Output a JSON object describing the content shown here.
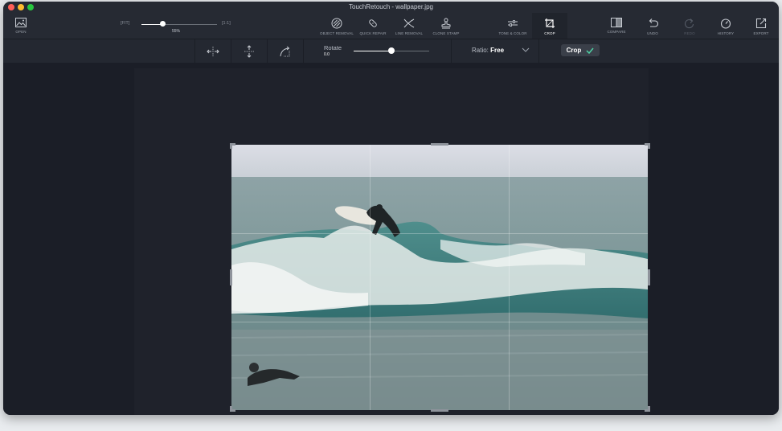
{
  "window": {
    "title": "TouchRetouch - wallpaper.jpg"
  },
  "toolbar": {
    "open_label": "OPEN",
    "zoom_fit_label": "FIT",
    "zoom_one_label": "1:1",
    "zoom_value": "55%",
    "zoom_fraction": 0.28,
    "object_removal_label": "OBJECT REMOVAL",
    "quick_repair_label": "QUICK REPAIR",
    "line_removal_label": "LINE REMOVAL",
    "clone_stamp_label": "CLONE STAMP",
    "tone_color_label": "TONE & COLOR",
    "crop_label": "CROP",
    "compare_label": "COMPARE",
    "undo_label": "UNDO",
    "redo_label": "REDO",
    "history_label": "HISTORY",
    "export_label": "EXPORT"
  },
  "crop_bar": {
    "rotate_label": "Rotate",
    "rotate_value": "0.0",
    "rotate_fraction": 0.5,
    "ratio_label": "Ratio:",
    "ratio_value": "Free",
    "crop_button_label": "Crop"
  },
  "colors": {
    "accent_check": "#4fd1a5",
    "bg": "#1b1e27",
    "toolbar": "#262a33"
  }
}
